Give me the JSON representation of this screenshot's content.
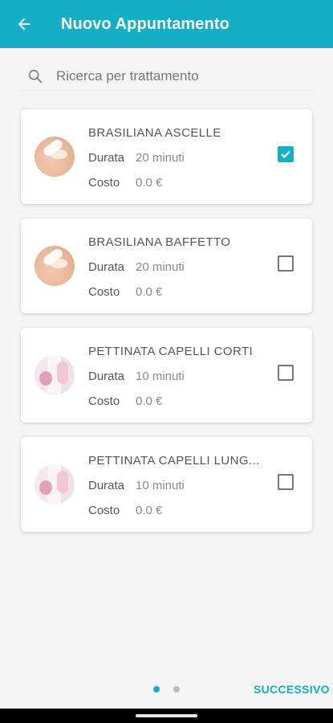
{
  "appbar": {
    "title": "Nuovo Appuntamento",
    "color": "#15aec4",
    "back_icon": "arrow-back-icon"
  },
  "search": {
    "placeholder": "Ricerca per trattamento",
    "icon": "search-icon"
  },
  "treatments": [
    {
      "name": "BRASILIANA ASCELLE",
      "durata_label": "Durata",
      "durata_value": "20 minuti",
      "costo_label": "Costo",
      "costo_value": "0.0 €",
      "checked": true,
      "thumb": "wax"
    },
    {
      "name": "BRASILIANA BAFFETTO",
      "durata_label": "Durata",
      "durata_value": "20 minuti",
      "costo_label": "Costo",
      "costo_value": "0.0 €",
      "checked": false,
      "thumb": "wax"
    },
    {
      "name": "PETTINATA CAPELLI CORTI",
      "durata_label": "Durata",
      "durata_value": "10 minuti",
      "costo_label": "Costo",
      "costo_value": "0.0 €",
      "checked": false,
      "thumb": "hair"
    },
    {
      "name": "PETTINATA CAPELLI LUNG...",
      "durata_label": "Durata",
      "durata_value": "10 minuti",
      "costo_label": "Costo",
      "costo_value": "0.0 €",
      "checked": false,
      "thumb": "hair"
    }
  ],
  "footer": {
    "next_label": "SUCCESSIVO",
    "pages": 2,
    "active_page": 1,
    "dot_active_color": "#15aec4",
    "dot_inactive_color": "#bdbdbd"
  }
}
